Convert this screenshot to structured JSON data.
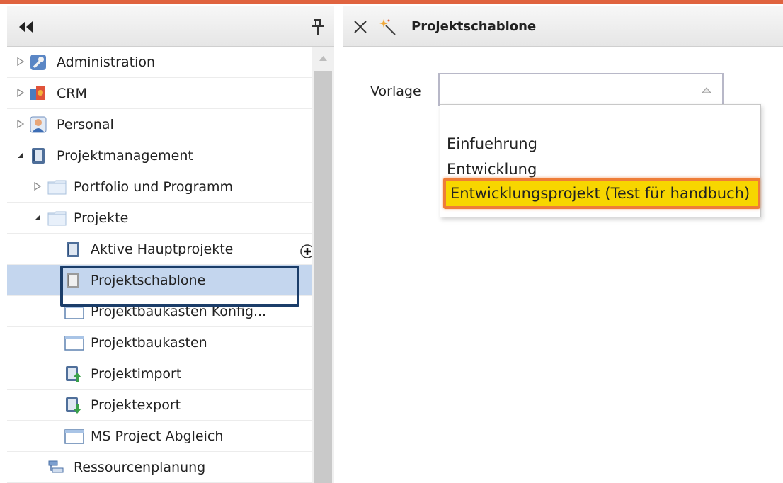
{
  "colors": {
    "accent_stripe": "#e0633f",
    "selection_bg": "#c4d6ee",
    "selection_outline": "#1b3d69",
    "option_highlight": "#f7d600",
    "option_highlight_border": "#ee7d38"
  },
  "left_panel": {
    "collapse_icon": "double-chevron-left-icon",
    "pin_icon": "pin-icon",
    "tree": [
      {
        "label": "Administration",
        "expander": "collapsed",
        "icon": "wrench-icon"
      },
      {
        "label": "CRM",
        "expander": "collapsed",
        "icon": "crm-icon"
      },
      {
        "label": "Personal",
        "expander": "collapsed",
        "icon": "person-icon"
      },
      {
        "label": "Projektmanagement",
        "expander": "expanded",
        "icon": "book-icon"
      },
      {
        "label": "Portfolio und Programm",
        "expander": "collapsed",
        "icon": "folder-icon"
      },
      {
        "label": "Projekte",
        "expander": "expanded",
        "icon": "folder-icon"
      },
      {
        "label": "Aktive Hauptprojekte",
        "expander": "none",
        "icon": "book-icon"
      },
      {
        "label": "Projektschablone",
        "expander": "none",
        "icon": "template-icon",
        "selected": true
      },
      {
        "label": "Projektbaukasten Konfig...",
        "expander": "none",
        "icon": "window-icon"
      },
      {
        "label": "Projektbaukasten",
        "expander": "none",
        "icon": "window-icon"
      },
      {
        "label": "Projektimport",
        "expander": "none",
        "icon": "import-icon"
      },
      {
        "label": "Projektexport",
        "expander": "none",
        "icon": "export-icon"
      },
      {
        "label": "MS Project Abgleich",
        "expander": "none",
        "icon": "window-icon"
      },
      {
        "label": "Ressourcenplanung",
        "expander": "none",
        "icon": "resource-icon"
      }
    ]
  },
  "right_panel": {
    "title": "Projektschablone",
    "form": {
      "label": "Vorlage",
      "value": "",
      "options": [
        "Einfuehrung",
        "Entwicklung",
        "Entwicklungsprojekt (Test für handbuch)"
      ],
      "highlighted_option": "Entwicklungsprojekt (Test für handbuch)"
    }
  }
}
